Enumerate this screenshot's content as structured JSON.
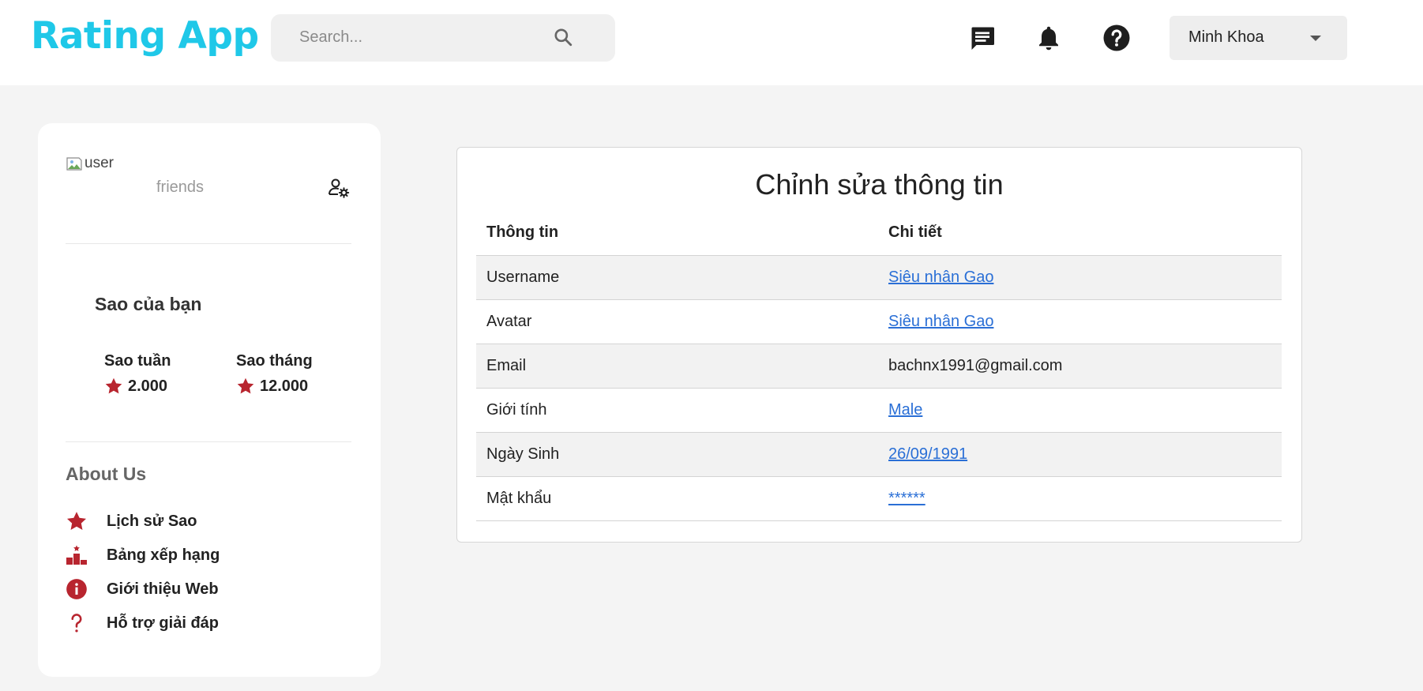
{
  "app": {
    "title": "Rating App",
    "brand_color": "#1fc8e8",
    "accent_color": "#b8252f"
  },
  "header": {
    "search": {
      "placeholder": "Search...",
      "icon": "search-icon"
    },
    "icons": [
      "chat-icon",
      "bell-icon",
      "help-circle-icon"
    ],
    "user_menu": {
      "name": "Minh Khoa",
      "icon": "caret-down-icon"
    }
  },
  "sidebar": {
    "avatar_alt": "user",
    "friends_label": "friends",
    "stars": {
      "title": "Sao của bạn",
      "week_label": "Sao tuần",
      "week_value": "2.000",
      "month_label": "Sao tháng",
      "month_value": "12.000"
    },
    "about": {
      "title": "About Us",
      "items": [
        {
          "label": "Lịch sử Sao",
          "icon": "star-icon"
        },
        {
          "label": "Bảng xếp hạng",
          "icon": "podium-icon"
        },
        {
          "label": "Giới thiệu Web",
          "icon": "info-icon"
        },
        {
          "label": "Hỗ trợ giải đáp",
          "icon": "question-icon"
        }
      ]
    }
  },
  "main": {
    "title": "Chỉnh sửa thông tin",
    "table": {
      "headers": [
        "Thông tin",
        "Chi tiết"
      ],
      "rows": [
        {
          "field": "Username",
          "value": "Siêu nhân Gao",
          "editable": true
        },
        {
          "field": "Avatar",
          "value": "Siêu nhân Gao",
          "editable": true
        },
        {
          "field": "Email",
          "value": "bachnx1991@gmail.com",
          "editable": false
        },
        {
          "field": "Giới tính",
          "value": "Male",
          "editable": true
        },
        {
          "field": "Ngày Sinh",
          "value": "26/09/1991",
          "editable": true
        },
        {
          "field": "Mật khẩu",
          "value": "******",
          "editable": true
        }
      ]
    }
  }
}
